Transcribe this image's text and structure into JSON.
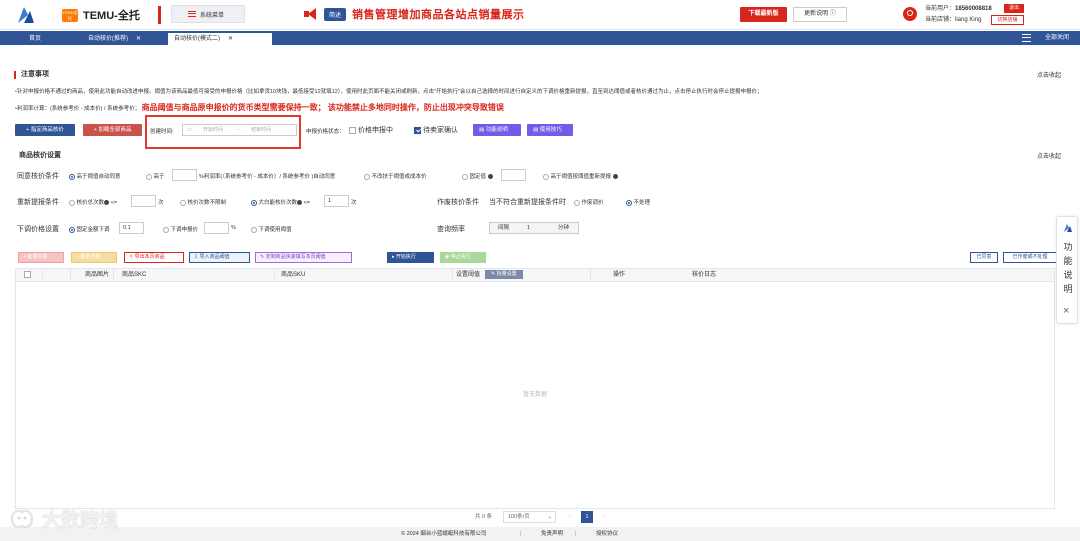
{
  "header": {
    "brand_badge": "TEMU全托",
    "brand_name": "TEMU-全托",
    "system_menu": "系统菜单",
    "announce_tag": "简述",
    "announce_text": "销售管理增加商品各站点销量展示",
    "download_label": "下载最新版",
    "update_label": "更新说明",
    "user_label": "当前用户：",
    "user_phone": "18560008818",
    "store_label": "当前店铺：",
    "store_name": "liang King",
    "logout_label": "退出",
    "switch_store_label": "切换店铺"
  },
  "tabs": [
    {
      "label": "首页"
    },
    {
      "label": "自动核价(推荐)"
    },
    {
      "label": "自动核价(模式二)"
    }
  ],
  "close_all_label": "全部关闭",
  "notice": {
    "title": "注意事项",
    "collapse_label": "点击收起",
    "line1": "针对申报价格不通过的商品，使用此功能自动改进申报。阈值为该商品最低可接受的申报价格（比如拿货10块钱，最低接受12就填12），使用时此页面不能关闭或刷新，点击\"开始执行\"会以自己选择的时间进行自定义的下调价格重新提报，直至到达阈值或者核价通过为止，点击停止执行时会停止提报申报价；",
    "line2_prefix": "利润率计算：(系统参考价 - 成本价) / 系统参考价；",
    "line2_warn": "商品阈值与商品原申报价的货币类型需要保持一致；   该功能禁止多地同时操作，防止出现冲突导致错误"
  },
  "toolbar1": {
    "specify_btn": "+ 指定商品核价",
    "load_all_btn": "+ 加载全部商品",
    "created_label": "创建时间:",
    "start_placeholder": "开始时间",
    "range_sep": "-",
    "end_placeholder": "结束时间",
    "status_label": "申报价格状态：",
    "status_opt1": "价格申报中",
    "status_opt2": "待卖家确认",
    "func_desc_btn": "功能说明",
    "tips_btn": "使用技巧"
  },
  "settings": {
    "title": "商品核价设置",
    "collapse_label": "点击收起",
    "agree_label": "同意核价条件",
    "agree_opt1": "高于阈值自动同意",
    "agree_opt2_prefix": "高于",
    "agree_opt2_suffix": "%利润率(（系统参考价 - 成本价）/ 系统参考价 )自动同意",
    "agree_opt3": "不改扶于阈值或成本价",
    "agree_opt4": "固定值",
    "agree_opt5": "高于阈值按阈值重新提报",
    "resubmit_label": "重新提报条件",
    "resubmit_opt1_prefix": "核价总次数",
    "resubmit_opt1_op": "<=",
    "resubmit_opt1_suffix": "次",
    "resubmit_opt2": "核价次数不限制",
    "resubmit_opt3_prefix": "大白能核价次数",
    "resubmit_opt3_op": "<=",
    "resubmit_opt3_value": "1",
    "resubmit_opt3_suffix": "次",
    "void_label": "作废核价条件",
    "void_sub": "当不符合重新提报条件时",
    "void_opt1": "作废调价",
    "void_opt2": "不处理",
    "lower_label": "下调价格设置",
    "lower_opt1_prefix": "固定金额下调",
    "lower_opt1_value": "0.1",
    "lower_opt2_prefix": "下调申报价",
    "lower_opt2_suffix": "%",
    "lower_opt3": "下调使用阈值",
    "freq_label": "查询频率",
    "freq_prefix": "间隔",
    "freq_value": "1",
    "freq_suffix": "分钟"
  },
  "toolbar2": {
    "batch_agree": "批量同意",
    "batch_void": "批量作废",
    "export_page": "导出本页商品",
    "import_threshold": "导入商品阈值",
    "custom_fill": "定制商品快速填写本页阈值",
    "start_btn": "开始执行",
    "stop_btn": "停止执行",
    "agreed_btn": "已同意",
    "voided_btn": "已作废或不处理"
  },
  "table": {
    "headers": [
      "商品图片",
      "商品SKC",
      "商品SKU",
      "设置阈值",
      "操作",
      "核价日志"
    ],
    "batch_set": "批量设置",
    "empty_text": "暂无数据"
  },
  "pager": {
    "total": "共 0 条",
    "page_size": "100条/页",
    "current_page": "1"
  },
  "footer": {
    "copyright": "© 2024 烟台小蓝蜻蜓科技有限公司",
    "disclaimer": "免责声明",
    "license": "授权协议"
  },
  "side_panel": {
    "text": "功能说明",
    "close": "×"
  },
  "watermark": {
    "text": "大数跨境"
  },
  "colors": {
    "primary": "#2f5597",
    "danger": "#d9261c",
    "purple": "#6f5de7"
  }
}
